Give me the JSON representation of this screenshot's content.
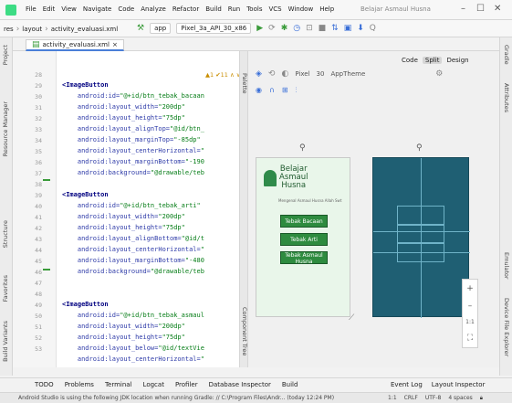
{
  "menubar": {
    "items": [
      "File",
      "Edit",
      "View",
      "Navigate",
      "Code",
      "Analyze",
      "Refactor",
      "Build",
      "Run",
      "Tools",
      "VCS",
      "Window",
      "Help"
    ],
    "window_title": "Belajar Asmaul Husna",
    "minimize": "–",
    "maximize": "☐",
    "close": "✕"
  },
  "navbar": {
    "crumb_res": "res",
    "crumb_layout": "layout",
    "crumb_file": "activity_evaluasi.xml",
    "run_config": "app",
    "device": "Pixel_3a_API_30_x86",
    "search": "Q"
  },
  "file_tab": {
    "label": "activity_evaluasi.xml",
    "close": "×"
  },
  "editor": {
    "info": "▲1 ✔11 ∧ ∨",
    "line_numbers": [
      "28",
      "29",
      "30",
      "31",
      "32",
      "33",
      "34",
      "35",
      "36",
      "37",
      "38",
      "39",
      "40",
      "41",
      "42",
      "43",
      "44",
      "45",
      "46",
      "47",
      "48",
      "49",
      "50",
      "51",
      "52",
      "53"
    ],
    "lines": [
      {
        "tag": "<ImageButton"
      },
      {
        "attr": "android:id=",
        "val": "\"@+id/btn_tebak_bacaan"
      },
      {
        "attr": "android:layout_width=",
        "val": "\"200dp\""
      },
      {
        "attr": "android:layout_height=",
        "val": "\"75dp\""
      },
      {
        "attr": "android:layout_alignTop=",
        "val": "\"@id/btn_"
      },
      {
        "attr": "android:layout_marginTop=",
        "val": "\"-85dp\""
      },
      {
        "attr": "android:layout_centerHorizontal=",
        "val": "\""
      },
      {
        "attr": "android:layout_marginBottom=",
        "val": "\"-190"
      },
      {
        "attr": "android:background=",
        "val": "\"@drawable/teb"
      },
      {
        "tag": ""
      },
      {
        "tag": "<ImageButton"
      },
      {
        "attr": "android:id=",
        "val": "\"@+id/btn_tebak_arti\""
      },
      {
        "attr": "android:layout_width=",
        "val": "\"200dp\""
      },
      {
        "attr": "android:layout_height=",
        "val": "\"75dp\""
      },
      {
        "attr": "android:layout_alignBottom=",
        "val": "\"@id/t"
      },
      {
        "attr": "android:layout_centerHorizontal=",
        "val": "\""
      },
      {
        "attr": "android:layout_marginBottom=",
        "val": "\"-480"
      },
      {
        "attr": "android:background=",
        "val": "\"@drawable/teb"
      },
      {
        "tag": ""
      },
      {
        "tag": "<ImageButton"
      },
      {
        "attr": "android:id=",
        "val": "\"@+id/btn_tebak_asmaul"
      },
      {
        "attr": "android:layout_width=",
        "val": "\"200dp\""
      },
      {
        "attr": "android:layout_height=",
        "val": "\"75dp\""
      },
      {
        "attr": "android:layout_below=",
        "val": "\"@id/textVie"
      },
      {
        "attr": "android:layout_centerHorizontal=",
        "val": "\""
      }
    ]
  },
  "split_label": "Palette",
  "split_label2": "Component Tree",
  "design_modes": {
    "code": "Code",
    "split": "Split",
    "design": "Design"
  },
  "design_toolbar": {
    "device": "Pixel",
    "api": "30",
    "theme": "AppTheme"
  },
  "preview": {
    "title": "Belajar\nAsmaul\nHusna",
    "subtitle": "Mengenal Asmaul Husna Allah Swt",
    "buttons": [
      "Tebak Bacaan",
      "Tebak Arti",
      "Tebak Asmaul Husna"
    ]
  },
  "zoom": {
    "plus": "+",
    "minus": "–",
    "ratio": "1:1"
  },
  "left_tools": [
    "Project",
    "Resource Manager",
    "Structure",
    "Favorites",
    "Build Variants"
  ],
  "right_tools": [
    "Gradle",
    "Attributes",
    "Emulator",
    "Device File Explorer"
  ],
  "bottom_tabs": [
    "TODO",
    "Problems",
    "Terminal",
    "Logcat",
    "Profiler",
    "Database Inspector",
    "Build"
  ],
  "bottom_right": [
    "Event Log",
    "Layout Inspector"
  ],
  "statusbar": {
    "message": "Android Studio is using the following JDK location when running Gradle: // C:\\Program Files\\Andr... (today 12:24 PM)",
    "position": "1:1",
    "line_sep": "CRLF",
    "encoding": "UTF-8",
    "indent": "4 spaces"
  }
}
